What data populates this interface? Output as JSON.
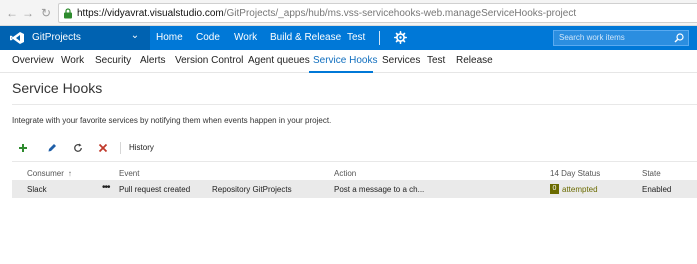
{
  "browser": {
    "url_host": "https://vidyavrat.visualstudio.com",
    "url_path": "/GitProjects/_apps/hub/ms.vss-servicehooks-web.manageServiceHooks-project"
  },
  "topbar": {
    "project_name": "GitProjects",
    "nav": [
      "Home",
      "Code",
      "Work",
      "Build & Release",
      "Test"
    ],
    "search_placeholder": "Search work items"
  },
  "hub_tabs": [
    "Overview",
    "Work",
    "Security",
    "Alerts",
    "Version Control",
    "Agent queues",
    "Service Hooks",
    "Services",
    "Test",
    "Release"
  ],
  "active_tab": "Service Hooks",
  "page": {
    "title": "Service Hooks",
    "description": "Integrate with your favorite services by notifying them when events happen in your project."
  },
  "toolbar": {
    "history_label": "History",
    "icons": [
      "add-icon",
      "edit-icon",
      "refresh-icon",
      "delete-icon"
    ]
  },
  "table": {
    "headers": {
      "consumer": "Consumer",
      "event": "Event",
      "action": "Action",
      "status": "14 Day Status",
      "state": "State"
    },
    "rows": [
      {
        "consumer": "Slack",
        "event": "Pull request created",
        "event_detail": "Repository GitProjects",
        "action": "Post a message to a ch...",
        "status_count": "0",
        "status_text": "attempted",
        "state": "Enabled"
      }
    ]
  },
  "colors": {
    "brand_blue": "#0078d7",
    "project_blue": "#0062b1",
    "active_tab": "#106ebe",
    "status_olive": "#6b6b00",
    "add_green": "#2e8b2e",
    "delete_red": "#c0392b"
  }
}
